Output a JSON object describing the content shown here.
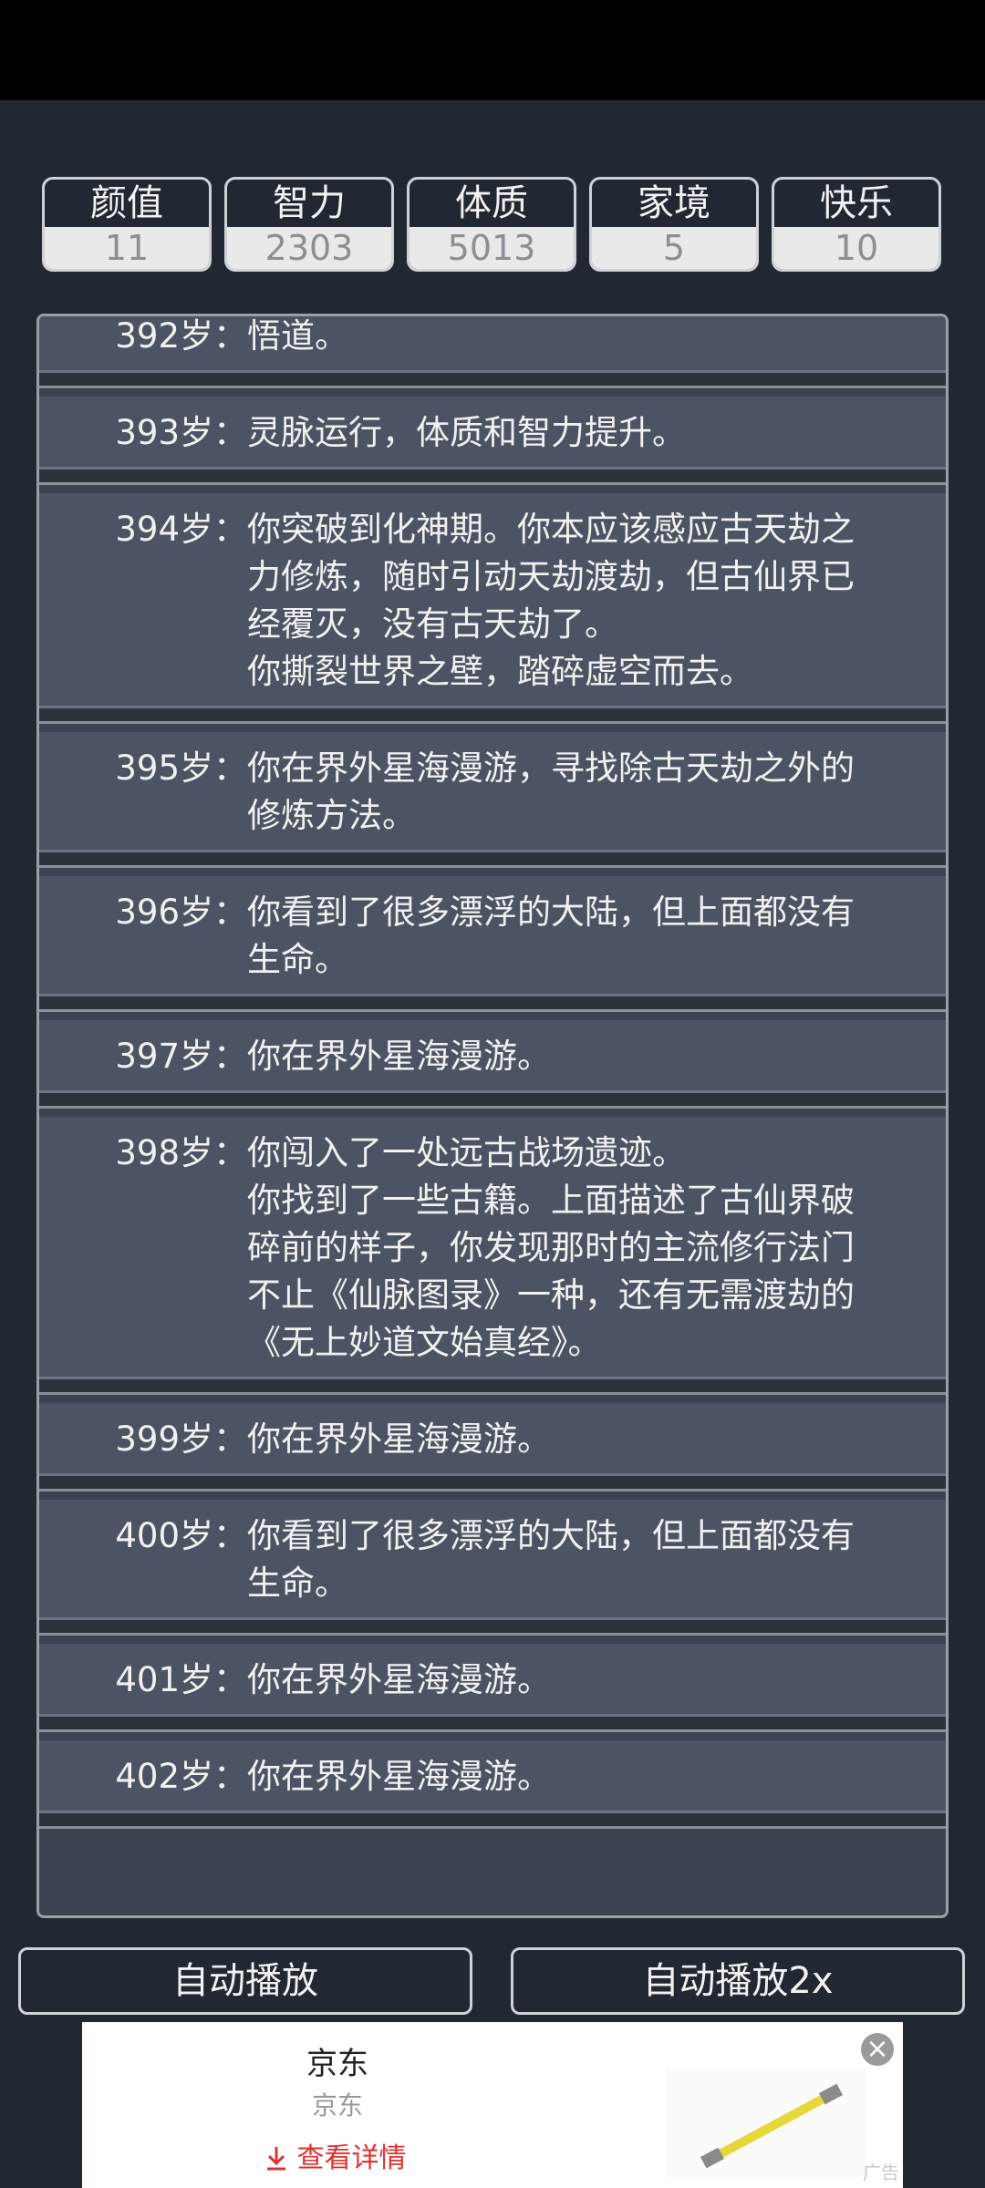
{
  "stats": [
    {
      "label": "颜值",
      "value": "11"
    },
    {
      "label": "智力",
      "value": "2303"
    },
    {
      "label": "体质",
      "value": "5013"
    },
    {
      "label": "家境",
      "value": "5"
    },
    {
      "label": "快乐",
      "value": "10"
    }
  ],
  "log": [
    {
      "age": "392岁：",
      "text": "悟道。"
    },
    {
      "age": "393岁：",
      "text": "灵脉运行，体质和智力提升。"
    },
    {
      "age": "394岁：",
      "text": "你突破到化神期。你本应该感应古天劫之\n力修炼，随时引动天劫渡劫，但古仙界已\n经覆灭，没有古天劫了。\n你撕裂世界之壁，踏碎虚空而去。"
    },
    {
      "age": "395岁：",
      "text": "你在界外星海漫游，寻找除古天劫之外的\n修炼方法。"
    },
    {
      "age": "396岁：",
      "text": "你看到了很多漂浮的大陆，但上面都没有\n生命。"
    },
    {
      "age": "397岁：",
      "text": "你在界外星海漫游。"
    },
    {
      "age": "398岁：",
      "text": "你闯入了一处远古战场遗迹。\n你找到了一些古籍。上面描述了古仙界破\n碎前的样子，你发现那时的主流修行法门\n不止《仙脉图录》一种，还有无需渡劫的\n《无上妙道文始真经》。"
    },
    {
      "age": "399岁：",
      "text": "你在界外星海漫游。"
    },
    {
      "age": "400岁：",
      "text": "你看到了很多漂浮的大陆，但上面都没有\n生命。"
    },
    {
      "age": "401岁：",
      "text": "你在界外星海漫游。"
    },
    {
      "age": "402岁：",
      "text": "你在界外星海漫游。"
    }
  ],
  "buttons": {
    "auto_play": "自动播放",
    "auto_play_2x": "自动播放2x"
  },
  "ad": {
    "title": "京东",
    "subtitle": "京东",
    "cta_icon": "download-arrow-icon",
    "cta": "查看详情",
    "close_icon": "close-icon",
    "tag": "广告"
  }
}
